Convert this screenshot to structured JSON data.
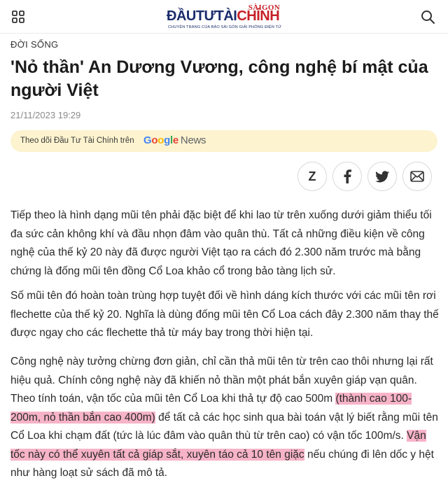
{
  "header": {
    "logo_saigon": "SÀIGON",
    "logo_brand_part1": "ĐẦUTƯTÀI",
    "logo_brand_part2": "CHÍNH",
    "logo_tagline": "CHUYÊN TRANG CỦA BÁO SÀI GÒN GIẢI PHÓNG ĐIỆN TỬ",
    "menu_icon": "grid-menu-icon",
    "search_icon": "search-icon"
  },
  "article": {
    "category": "ĐỜI SỐNG",
    "title": "'Nỏ thần' An Dương Vương, công nghệ bí mật của người Việt",
    "date": "21/11/2023 19:29",
    "follow": {
      "text": "Theo dõi Đầu Tư Tài Chính trên",
      "google_letters": [
        "G",
        "o",
        "o",
        "g",
        "l",
        "e"
      ],
      "news": "News"
    },
    "share_buttons": [
      {
        "icon": "zalo-icon",
        "label": "Z"
      },
      {
        "icon": "facebook-icon"
      },
      {
        "icon": "twitter-icon"
      },
      {
        "icon": "email-icon"
      }
    ],
    "paragraphs": {
      "p1": "Tiếp theo là hình dạng mũi tên phải đặc biệt để khi lao từ trên xuống dưới giảm thiểu tối đa sức cản không khí và đầu nhọn đâm vào quân thù. Tất cả những điều kiện về công nghệ của thế kỷ 20 này đã được người Việt tạo ra cách đó 2.300 năm trước mà bằng chứng là đống mũi tên đồng Cổ Loa khảo cổ trong bảo tàng lịch sử.",
      "p2": "Số mũi tên đó hoàn toàn trùng hợp tuyệt đối về hình dáng kích thước với các mũi tên rơi flechette của thế kỷ 20. Nghĩa là dùng đống mũi tên Cổ Loa cách đây 2.300 năm thay thế được ngay cho các flechette thả từ máy bay trong thời hiện tại.",
      "p3_a": "Công nghệ này tưởng chừng đơn giản, chỉ cần thả mũi tên từ trên cao thôi nhưng lại rất hiệu quả. Chính công nghệ này đã khiến nỏ thần một phát bắn xuyên giáp vạn quân. Theo tính toán, vận tốc của mũi tên Cổ Loa khi thả tự độ cao 500m ",
      "p3_hl1": "(thành cao 100-200m, nỏ thần bắn cao 400m)",
      "p3_b": " để tất cả các học sinh qua bài toán vật lý biết rằng mũi tên Cổ Loa khi chạm đất (tức là lúc đâm vào quân thù từ trên cao) có vận tốc 100m/s. ",
      "p3_hl2": "Vận tốc này có thể xuyên tất cả giáp sắt, xuyên táo cả 10 tên giặc",
      "p3_c": " nếu chúng đi lên dốc y hệt như hàng loạt sử sách đã mô tả."
    }
  },
  "colors": {
    "brand_blue": "#1a2c6b",
    "brand_red": "#c62026",
    "follow_bg": "#fdf3cf",
    "highlight": "#f7b3c8"
  }
}
